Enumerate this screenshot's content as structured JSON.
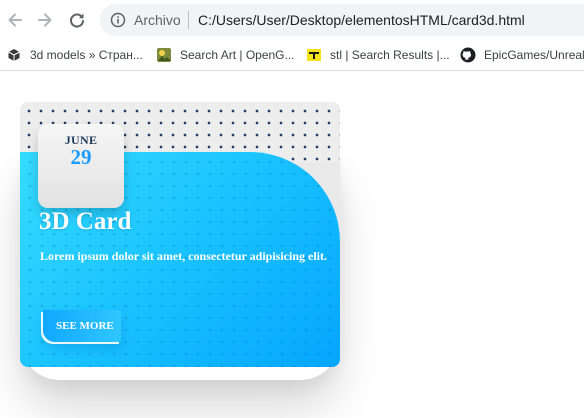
{
  "browser": {
    "address_scheme": "Archivo",
    "address_url": "C:/Users/User/Desktop/elementosHTML/card3d.html",
    "icons": {
      "back": "arrow-left-icon",
      "forward": "arrow-right-icon",
      "reload": "reload-icon",
      "site_info": "info-icon"
    }
  },
  "bookmarks": [
    {
      "label": "3d models » Стран...",
      "icon": "cube-icon"
    },
    {
      "label": "Search Art | OpenG...",
      "icon": "opengameart-icon"
    },
    {
      "label": "stl | Search Results |...",
      "icon": "thingiverse-icon"
    },
    {
      "label": "EpicGames/UnrealE",
      "icon": "github-icon"
    }
  ],
  "card": {
    "month": "JUNE",
    "day": "29",
    "title": "3D Card",
    "description": "Lorem ipsum dolor sit amet, consectetur adipisicing elit.",
    "button_label": "SEE MORE",
    "colors": {
      "gradient_start": "#35dcff",
      "gradient_end": "#04a6ff",
      "pattern_dot": "#1c3f66",
      "day_text": "#1c9bff",
      "month_text": "#1e3a5a"
    }
  }
}
